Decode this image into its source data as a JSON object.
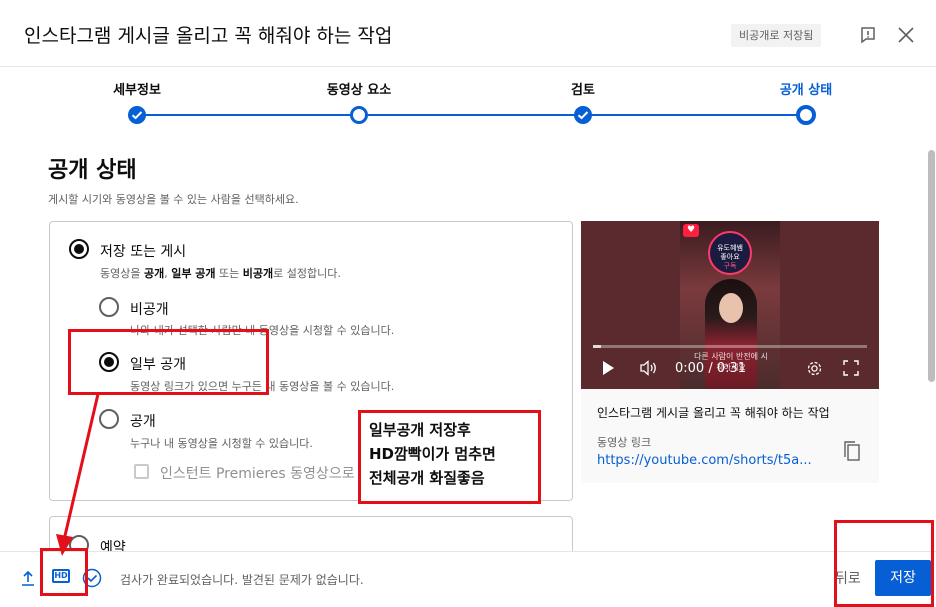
{
  "header": {
    "title": "인스타그램 게시글 올리고 꼭 해줘야 하는 작업",
    "draft_badge": "비공개로 저장됨"
  },
  "stepper": {
    "steps": [
      {
        "label": "세부정보",
        "state": "done"
      },
      {
        "label": "동영상 요소",
        "state": "visited"
      },
      {
        "label": "검토",
        "state": "done"
      },
      {
        "label": "공개 상태",
        "state": "active"
      }
    ]
  },
  "visibility": {
    "title": "공개 상태",
    "subtitle": "게시할 시기와 동영상을 볼 수 있는 사람을 선택하세요.",
    "save_or_publish": {
      "label": "저장 또는 게시",
      "desc_parts": [
        "동영상을 ",
        "공개",
        ", ",
        "일부 공개",
        " 또는 ",
        "비공개",
        "로 설정합니다."
      ]
    },
    "options": [
      {
        "label": "비공개",
        "desc": "나와 내가 선택한 사람만 내 동영상을 시청할 수 있습니다.",
        "checked": false
      },
      {
        "label": "일부 공개",
        "desc": "동영상 링크가 있으면 누구든 내 동영상을 볼 수 있습니다.",
        "checked": true
      },
      {
        "label": "공개",
        "desc": "누구나 내 동영상을 시청할 수 있습니다.",
        "checked": false
      }
    ],
    "premiere_checkbox": "인스턴트 Premieres 동영상으로 설정",
    "schedule_label": "예약"
  },
  "video": {
    "time": "0:00 / 0:31",
    "badge_text": [
      "유도혜쌤",
      "좋아요",
      "구독"
    ],
    "overlay_text": "다른 사람이 반전에 시작하세요",
    "title": "인스타그램 게시글 올리고 꼭 해줘야 하는 작업",
    "link_label": "동영상 링크",
    "link": "https://youtube.com/shorts/t5a..."
  },
  "footer": {
    "hd": "HD",
    "status": "검사가 완료되었습니다. 발견된 문제가 없습니다.",
    "back_label": "뒤로",
    "save_label": "저장"
  },
  "annotation": {
    "lines": [
      "일부공개 저장후",
      "HD깜빡이가 멈추면",
      "전체공개 화질좋음"
    ],
    "color": "#e3101a"
  },
  "colors": {
    "accent": "#065fd4",
    "text": "#0d0d0d",
    "secondary": "#606060"
  }
}
